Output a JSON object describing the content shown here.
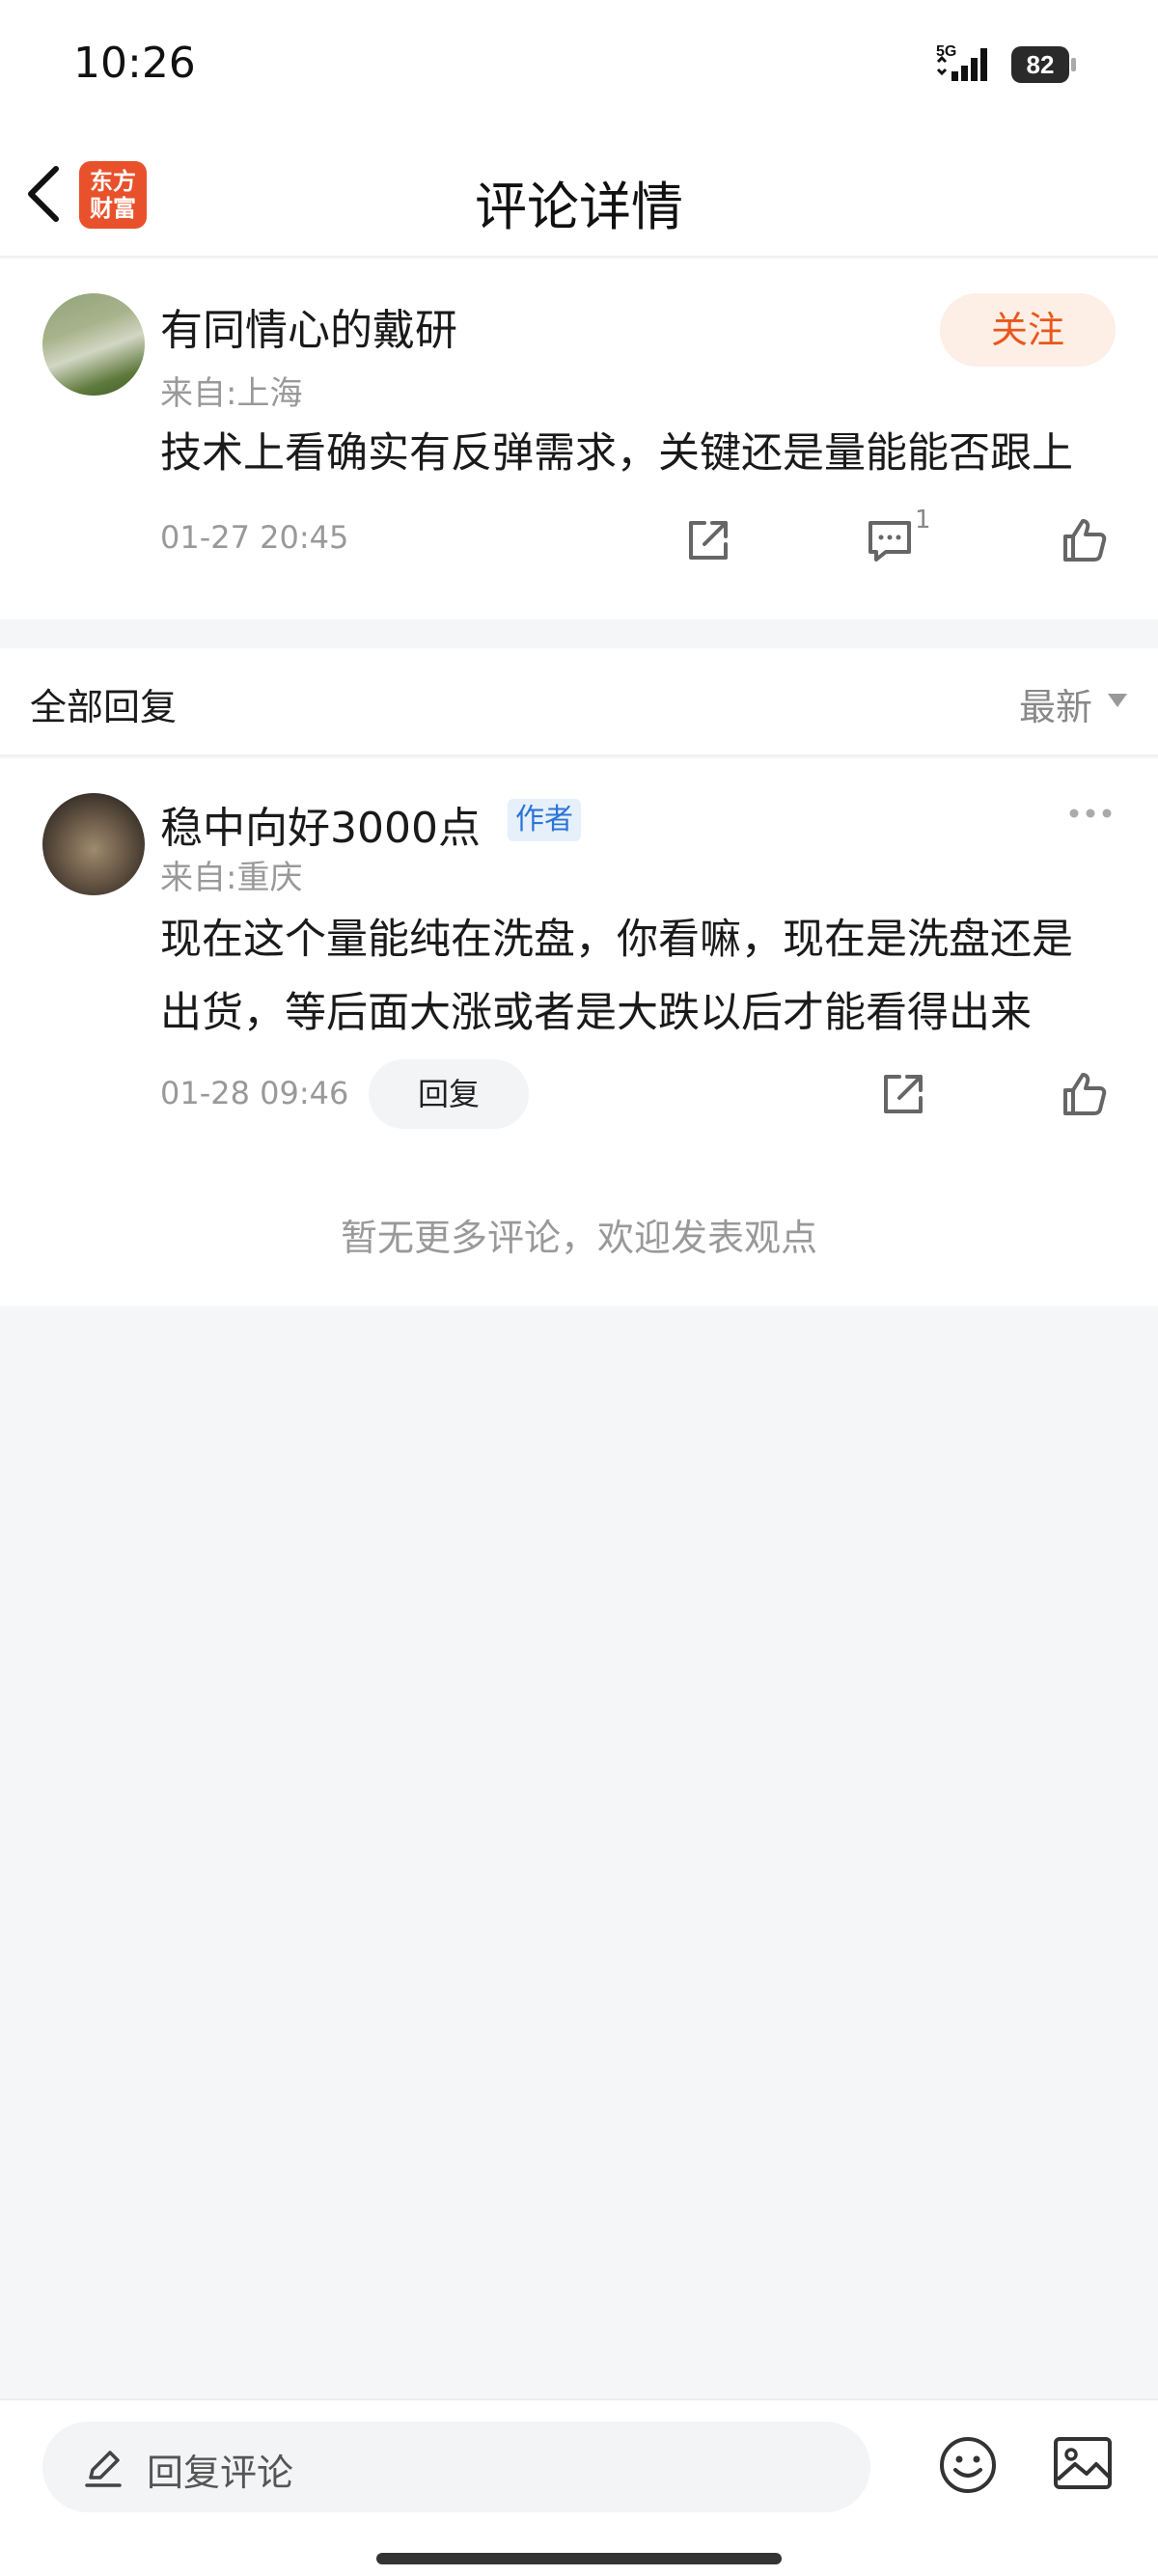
{
  "status_bar": {
    "time": "10:26",
    "network": "5G",
    "battery": "82"
  },
  "header": {
    "title": "评论详情",
    "logo_text_line1": "东方",
    "logo_text_line2": "财富"
  },
  "main_comment": {
    "username": "有同情心的戴研",
    "location": "来自:上海",
    "content": "技术上看确实有反弹需求，关键还是量能能否跟上",
    "timestamp": "01-27 20:45",
    "follow_label": "关注",
    "comment_count": "1"
  },
  "replies": {
    "title": "全部回复",
    "sort_label": "最新",
    "items": [
      {
        "username": "稳中向好3000点",
        "author_tag": "作者",
        "location": "来自:重庆",
        "content_line1": "现在这个量能纯在洗盘，你看嘛，现在是洗盘还是",
        "content_line2": "出货，等后面大涨或者是大跌以后才能看得出来",
        "timestamp": "01-28 09:46",
        "reply_label": "回复"
      }
    ],
    "no_more_text": "暂无更多评论，欢迎发表观点"
  },
  "bottom_bar": {
    "input_placeholder": "回复评论"
  },
  "colors": {
    "accent": "#e8581c",
    "follow_bg": "#fdeee6",
    "author_tag": "#2b74d6",
    "page_bg": "#f5f6f8"
  }
}
